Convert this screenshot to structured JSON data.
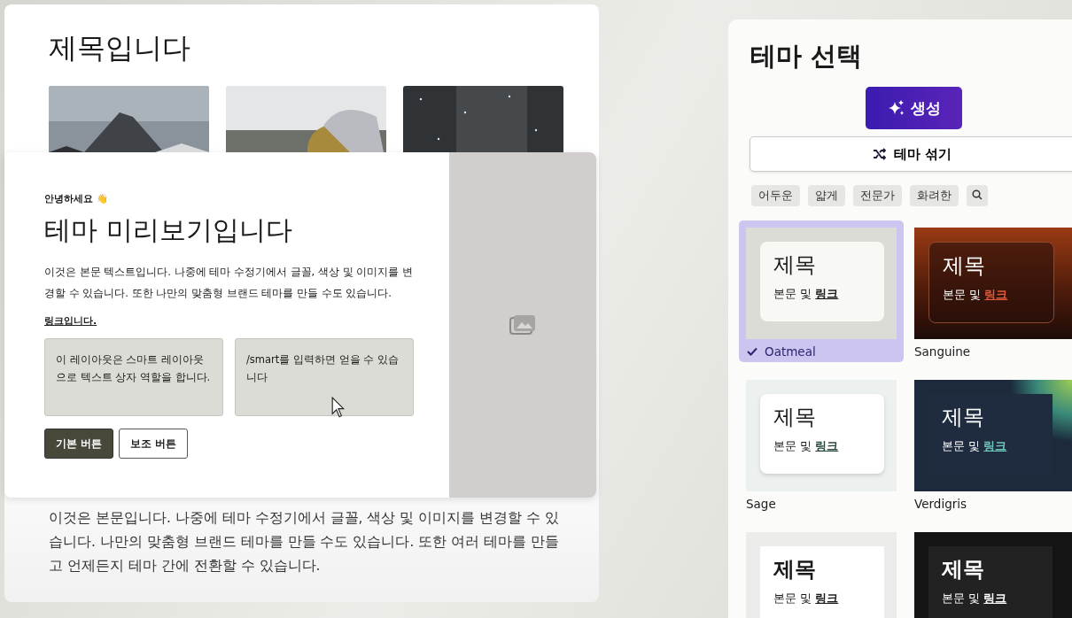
{
  "document": {
    "title": "제목입니다",
    "body": "이것은 본문입니다. 나중에 테마 수정기에서 글꼴, 색상 및 이미지를 변경할 수 있습니다. 나만의 맞춤형 브랜드 테마를 만들 수도 있습니다. 또한 여러 테마를 만들고 언제든지 테마 간에 전환할 수 있습니다."
  },
  "preview": {
    "greeting": "안녕하세요 👋",
    "heading": "테마 미리보기입니다",
    "paragraph": "이것은 본문 텍스트입니다. 나중에 테마 수정기에서 글꼴, 색상 및 이미지를 변경할 수 있습니다. 또한 나만의 맞춤형 브랜드 테마를 만들 수도 있습니다.",
    "link": "링크입니다.",
    "boxes": [
      "이 레이아웃은 스마트 레이아웃으로 텍스트 상자 역할을 합니다.",
      "/smart를 입력하면 얻을 수 있습니다"
    ],
    "buttons": [
      {
        "label": "기본 버튼",
        "kind": "primary"
      },
      {
        "label": "보조 버튼",
        "kind": "secondary"
      }
    ]
  },
  "panel": {
    "title": "테마 선택",
    "generate": "생성",
    "shuffle": "테마 섞기",
    "filters": [
      "어두운",
      "얇게",
      "전문가",
      "화려한"
    ],
    "themes": [
      {
        "kind": "oatmeal",
        "name": "Oatmeal",
        "selected": true,
        "title": "제목",
        "body": "본문 및",
        "link": "링크"
      },
      {
        "kind": "sanguine",
        "name": "Sanguine",
        "selected": false,
        "title": "제목",
        "body": "본문 및",
        "link": "링크"
      },
      {
        "kind": "sage",
        "name": "Sage",
        "selected": false,
        "title": "제목",
        "body": "본문 및",
        "link": "링크"
      },
      {
        "kind": "verdigris",
        "name": "Verdigris",
        "selected": false,
        "title": "제목",
        "body": "본문 및",
        "link": "링크"
      },
      {
        "kind": "plain",
        "selected": false,
        "title": "제목",
        "body": "본문 및",
        "link": "링크"
      },
      {
        "kind": "ink",
        "selected": false,
        "title": "제목",
        "body": "본문 및",
        "link": "링크"
      }
    ]
  }
}
